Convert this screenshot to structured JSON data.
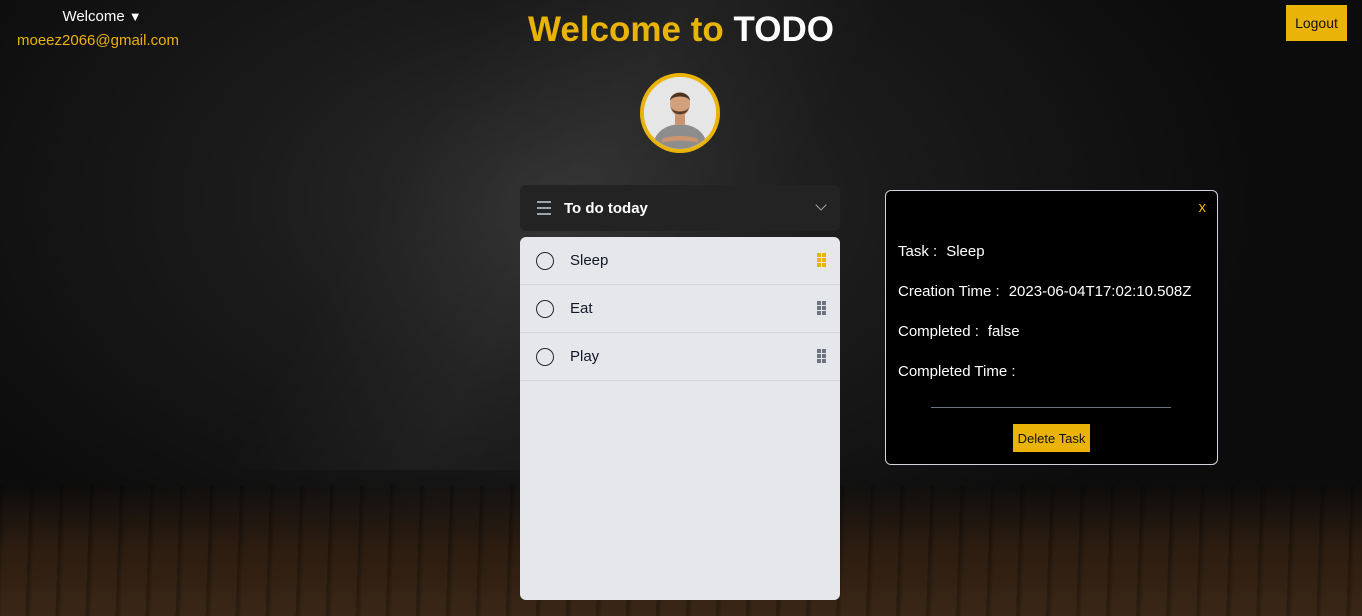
{
  "user_menu": {
    "welcome_label": "Welcome",
    "caret": "▼",
    "email": "moeez2066@gmail.com"
  },
  "header": {
    "title_part1": "Welcome to",
    "title_part2": "TODO",
    "logout_label": "Logout"
  },
  "list": {
    "title": "To do today",
    "items": [
      {
        "label": "Sleep"
      },
      {
        "label": "Eat"
      },
      {
        "label": "Play"
      }
    ]
  },
  "detail": {
    "close_label": "x",
    "task_label": "Task :",
    "task_value": "Sleep",
    "creation_label": "Creation Time :",
    "creation_value": "2023-06-04T17:02:10.508Z",
    "completed_label": "Completed :",
    "completed_value": "false",
    "completed_time_label": "Completed Time :",
    "completed_time_value": "",
    "delete_label": "Delete Task"
  },
  "colors": {
    "accent": "#eab308",
    "list_bg": "#e5e7eb",
    "panel_bg": "#000000"
  }
}
